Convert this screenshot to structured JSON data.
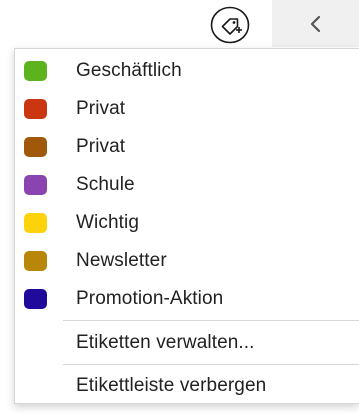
{
  "toolbar": {
    "tag_icon": "tag-plus-icon",
    "collapse_icon": "chevron-left-icon"
  },
  "menu": {
    "labels": [
      {
        "name": "Geschäftlich",
        "color": "#5cb31e"
      },
      {
        "name": "Privat",
        "color": "#c9360f"
      },
      {
        "name": "Privat",
        "color": "#a0590a"
      },
      {
        "name": "Schule",
        "color": "#8a44b0"
      },
      {
        "name": "Wichtig",
        "color": "#fcd20b"
      },
      {
        "name": "Newsletter",
        "color": "#b8870a"
      },
      {
        "name": "Promotion-Aktion",
        "color": "#1f0a9c"
      }
    ],
    "manage_label": "Etiketten verwalten...",
    "hide_bar_label": "Etikettleiste verbergen"
  }
}
